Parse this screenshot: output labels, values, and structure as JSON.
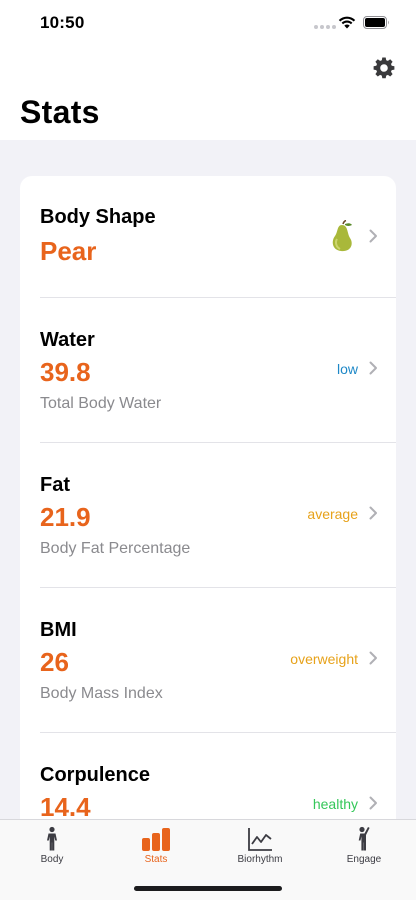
{
  "status_bar": {
    "time": "10:50"
  },
  "header": {
    "title": "Stats",
    "settings_icon": "gear-icon"
  },
  "stats": [
    {
      "title": "Body Shape",
      "value": "Pear",
      "icon": "pear-icon",
      "status": "",
      "subtitle": ""
    },
    {
      "title": "Water",
      "value": "39.8",
      "subtitle": "Total Body Water",
      "status": "low",
      "status_color": "#1e88c7"
    },
    {
      "title": "Fat",
      "value": "21.9",
      "subtitle": "Body Fat Percentage",
      "status": "average",
      "status_color": "#e7a21a"
    },
    {
      "title": "BMI",
      "value": "26",
      "subtitle": "Body Mass Index",
      "status": "overweight",
      "status_color": "#e7a21a"
    },
    {
      "title": "Corpulence",
      "value": "14.4",
      "subtitle": "",
      "status": "healthy",
      "status_color": "#34c759"
    }
  ],
  "tab_bar": {
    "active": "Stats",
    "accent_color": "#e8641c",
    "tabs": [
      {
        "label": "Body",
        "icon": "person-icon"
      },
      {
        "label": "Stats",
        "icon": "bar-chart-icon"
      },
      {
        "label": "Biorhythm",
        "icon": "line-chart-icon"
      },
      {
        "label": "Engage",
        "icon": "person-raised-hand-icon"
      }
    ]
  }
}
